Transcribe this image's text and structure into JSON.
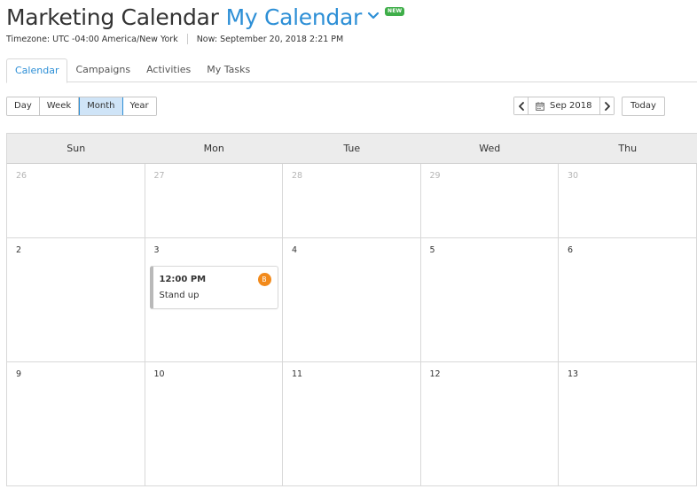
{
  "header": {
    "title": "Marketing Calendar",
    "calendar_selector": "My Calendar",
    "new_badge": "NEW",
    "timezone": "Timezone: UTC -04:00 America/New York",
    "now": "Now: September 20, 2018 2:21 PM"
  },
  "tabs": [
    {
      "label": "Calendar",
      "active": true
    },
    {
      "label": "Campaigns",
      "active": false
    },
    {
      "label": "Activities",
      "active": false
    },
    {
      "label": "My Tasks",
      "active": false
    }
  ],
  "views": [
    {
      "label": "Day",
      "active": false
    },
    {
      "label": "Week",
      "active": false
    },
    {
      "label": "Month",
      "active": true
    },
    {
      "label": "Year",
      "active": false
    }
  ],
  "date_nav": {
    "current": "Sep 2018",
    "today_label": "Today"
  },
  "icons": {
    "chevron": "chevron-down-icon",
    "prev": "chevron-left-icon",
    "next": "chevron-right-icon",
    "calendar": "calendar-icon"
  },
  "colors": {
    "accent": "#2d8fd6",
    "new_badge": "#3fae49",
    "event_badge": "#f28a1b",
    "header_bg": "#ececec"
  },
  "calendar": {
    "weekdays": [
      "Sun",
      "Mon",
      "Tue",
      "Wed",
      "Thu"
    ],
    "weeks": [
      {
        "days": [
          {
            "num": "26",
            "muted": true
          },
          {
            "num": "27",
            "muted": true
          },
          {
            "num": "28",
            "muted": true
          },
          {
            "num": "29",
            "muted": true
          },
          {
            "num": "30",
            "muted": true
          }
        ]
      },
      {
        "days": [
          {
            "num": "2",
            "muted": false
          },
          {
            "num": "3",
            "muted": false,
            "event": {
              "time": "12:00 PM",
              "title": "Stand up",
              "badge": "B"
            }
          },
          {
            "num": "4",
            "muted": false
          },
          {
            "num": "5",
            "muted": false
          },
          {
            "num": "6",
            "muted": false
          }
        ]
      },
      {
        "days": [
          {
            "num": "9",
            "muted": false
          },
          {
            "num": "10",
            "muted": false
          },
          {
            "num": "11",
            "muted": false
          },
          {
            "num": "12",
            "muted": false
          },
          {
            "num": "13",
            "muted": false
          }
        ]
      }
    ]
  }
}
